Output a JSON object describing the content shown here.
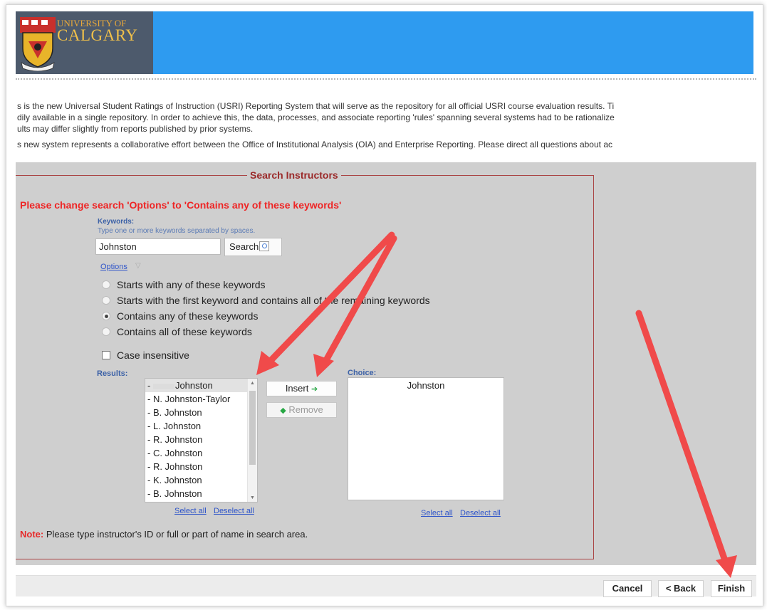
{
  "header": {
    "university_line1": "UNIVERSITY OF",
    "university_line2": "CALGARY"
  },
  "intro": {
    "line1": "s is the new Universal Student Ratings of Instruction (USRI) Reporting System that will serve as the repository for all official USRI course evaluation results.  Ti",
    "line2": "dily available in a single repository.  In order to achieve this, the data, processes, and associate reporting 'rules' spanning several systems had to be rationalize",
    "line3": "ults may differ slightly from reports published by prior systems.",
    "line4": "s new system represents a collaborative effort between the Office of Institutional Analysis (OIA) and Enterprise Reporting.  Please direct all questions about ac"
  },
  "search": {
    "legend": "Search Instructors",
    "warning": "Please change search 'Options' to 'Contains any of these keywords'",
    "keywords_label": "Keywords:",
    "keywords_help": "Type one or more keywords separated by spaces.",
    "keywords_value": "Johnston",
    "search_button": "Search",
    "options_link": "Options",
    "options": [
      {
        "label": "Starts with any of these keywords",
        "checked": false
      },
      {
        "label": "Starts with the first keyword and contains all of the remaining keywords",
        "checked": false
      },
      {
        "label": "Contains any of these keywords",
        "checked": true
      },
      {
        "label": "Contains all of these keywords",
        "checked": false
      }
    ],
    "case_insensitive": "Case insensitive",
    "results_label": "Results:",
    "results": [
      "Johnston",
      "- N. Johnston-Taylor",
      "- B. Johnston",
      "- L. Johnston",
      "- R. Johnston",
      "- C. Johnston",
      "- R. Johnston",
      "- K. Johnston",
      "- B. Johnston"
    ],
    "insert_button": "Insert",
    "remove_button": "Remove",
    "choice_label": "Choice:",
    "choice_items": [
      "Johnston"
    ],
    "select_all": "Select all",
    "deselect_all": "Deselect all",
    "note_label": "Note:",
    "note_text": " Please type instructor's ID or full or part of name in search area."
  },
  "footer": {
    "cancel": "Cancel",
    "back": "< Back",
    "finish": "Finish"
  },
  "colors": {
    "banner": "#2e9bf0",
    "panel": "#cfcfcf",
    "warning": "#ee2525",
    "annotation_arrow": "#f04a4a"
  }
}
